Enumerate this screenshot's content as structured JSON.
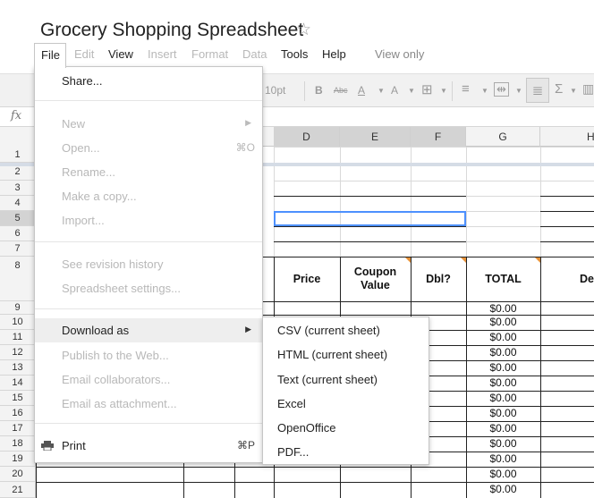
{
  "document": {
    "title": "Grocery Shopping Spreadsheet",
    "star_icon": "star-outline-icon"
  },
  "menubar": {
    "file": "File",
    "edit": "Edit",
    "view": "View",
    "insert": "Insert",
    "format": "Format",
    "data": "Data",
    "tools": "Tools",
    "help": "Help",
    "view_only": "View only"
  },
  "toolbar": {
    "font_size": "10pt",
    "bold": "B",
    "strike": "Abc",
    "text_color": "A",
    "fill_color": "A",
    "sum": "Σ"
  },
  "formula_bar": {
    "fx": "fx"
  },
  "columns": [
    "D",
    "E",
    "F",
    "G",
    "H"
  ],
  "rows": [
    "1",
    "2",
    "3",
    "4",
    "5",
    "6",
    "7",
    "8",
    "9",
    "10",
    "11",
    "12",
    "13",
    "14",
    "15",
    "16",
    "17",
    "18",
    "19",
    "20",
    "21"
  ],
  "headers": {
    "price": "Price",
    "coupon_value_line1": "Coupon",
    "coupon_value_line2": "Value",
    "dbl": "Dbl?",
    "total": "TOTAL",
    "de": "De"
  },
  "totals": [
    "$0.00",
    "$0.00",
    "$0.00",
    "$0.00",
    "$0.00",
    "$0.00",
    "$0.00",
    "$0.00",
    "$0.00",
    "$0.00",
    "$0.00",
    "$0.00",
    "$0.00"
  ],
  "file_menu": {
    "share": "Share...",
    "new": "New",
    "open": "Open...",
    "open_shortcut": "⌘O",
    "rename": "Rename...",
    "make_copy": "Make a copy...",
    "import": "Import...",
    "revision_history": "See revision history",
    "spreadsheet_settings": "Spreadsheet settings...",
    "download_as": "Download as",
    "publish": "Publish to the Web...",
    "email_collaborators": "Email collaborators...",
    "email_attachment": "Email as attachment...",
    "print": "Print",
    "print_shortcut": "⌘P"
  },
  "download_submenu": {
    "csv": "CSV (current sheet)",
    "html": "HTML (current sheet)",
    "text": "Text (current sheet)",
    "excel": "Excel",
    "openoffice": "OpenOffice",
    "pdf": "PDF..."
  }
}
